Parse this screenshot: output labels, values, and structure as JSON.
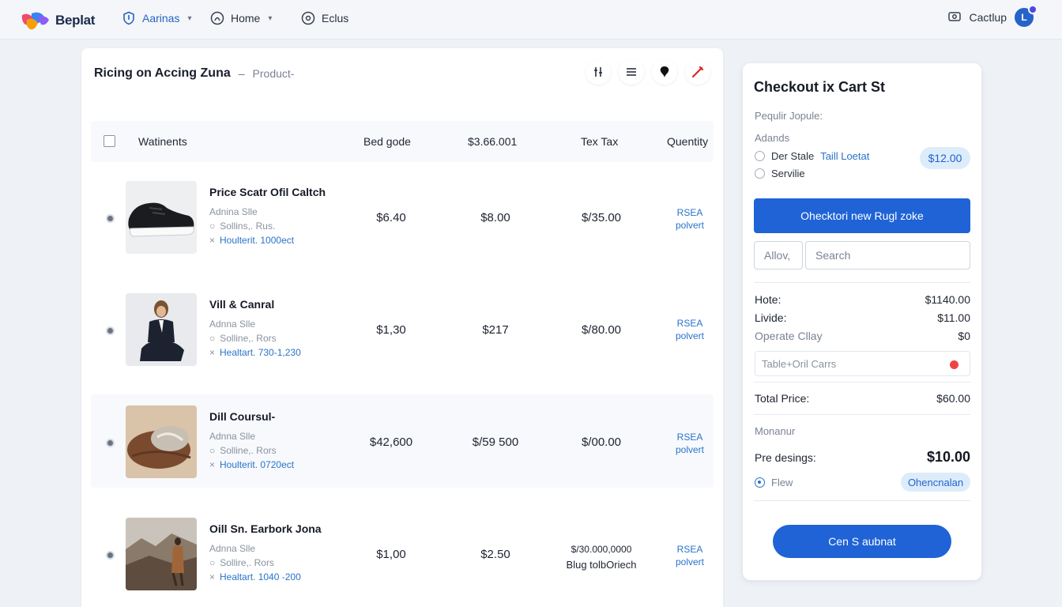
{
  "nav": {
    "brand": "Beplat",
    "items": [
      {
        "label": "Aarinas",
        "icon": "shield-icon",
        "has_caret": true,
        "active": true
      },
      {
        "label": "Home",
        "icon": "home-icon",
        "has_caret": true,
        "active": false
      },
      {
        "label": "Eclus",
        "icon": "settings-circle-icon",
        "has_caret": false,
        "active": false
      }
    ],
    "right_label": "Cactlup",
    "avatar_initial": "L"
  },
  "products": {
    "title": "Ricing on Accing Zuna",
    "separator": "–",
    "breadcrumb": "Product-",
    "tools": [
      "filter-icon",
      "menu-icon",
      "pin-icon",
      "tag-icon"
    ],
    "columns": {
      "name": "Watinents",
      "c1": "Bed gode",
      "c2": "$3.66.001",
      "c3": "Tex Tax",
      "c4": "Quentity"
    },
    "rows": [
      {
        "name": "Price Scatr Ofil Caltch",
        "meta1": "Adnina Slle",
        "meta2": "Sollins,. Rus.",
        "meta3": "Houlterit. 1000ect",
        "v1": "$6.40",
        "v2": "$8.00",
        "v3": "$/35.00",
        "v3b": "",
        "status1": "RSEA",
        "status2": "polvert",
        "image": "sneaker"
      },
      {
        "name": "Vill & Canral",
        "meta1": "Adnna Slle",
        "meta2": "Solline,. Rors",
        "meta3": "Healtart. 730-1,230",
        "v1": "$1,30",
        "v2": "$217",
        "v3": "$/80.00",
        "v3b": "",
        "status1": "RSEA",
        "status2": "polvert",
        "image": "man-in-suit"
      },
      {
        "name": "Dill Coursul-",
        "meta1": "Adnna Slle",
        "meta2": "Solline,. Rors",
        "meta3": "Houlterit. 0720ect",
        "v1": "$42,600",
        "v2": "$/59 500",
        "v3": "$/00.00",
        "v3b": "",
        "status1": "RSEA",
        "status2": "polvert",
        "image": "knit-cloth"
      },
      {
        "name": "Oill Sn. Earbork Jona",
        "meta1": "Adnna Slle",
        "meta2": "Sollire,. Rors",
        "meta3": "Healtart. 1040 -200",
        "v1": "$1,00",
        "v2": "$2.50",
        "v3": "$/30.000,0000",
        "v3b": "Blug tolbOriech",
        "status1": "RSEA",
        "status2": "polvert",
        "image": "mountain-hiker"
      }
    ]
  },
  "checkout": {
    "title": "Checkout ix Cart St",
    "subtitle": "Pequlir Jopule:",
    "addons_label": "Adands",
    "options": [
      {
        "text": "Der Stale",
        "link": "Taill Loetat"
      },
      {
        "text": "Servilie",
        "link": ""
      }
    ],
    "option_price": "$12.00",
    "primary_button": "Ohecktori new Rugl zoke",
    "field_a": "Allov,",
    "field_b_placeholder": "Search",
    "summary": [
      {
        "label": "Hote:",
        "value": "$1140.00",
        "muted": false
      },
      {
        "label": "Livide:",
        "value": "$11.00",
        "muted": false
      },
      {
        "label": "Operate Cllay",
        "value": "$0",
        "muted": true
      }
    ],
    "note_placeholder": "Table+Oril Carrs",
    "total_label": "Total Price:",
    "total_value": "$60.00",
    "muted_label": "Monanur",
    "pre_label": "Pre desings:",
    "pre_value": "$10.00",
    "new_label": "Flew",
    "pill_label": "Ohencnalan",
    "cta": "Cen S aubnat"
  },
  "colors": {
    "accent": "#1f63d6",
    "link": "#2a73c9",
    "pill_bg": "#dcecfb",
    "page_bg": "#eef1f5"
  }
}
